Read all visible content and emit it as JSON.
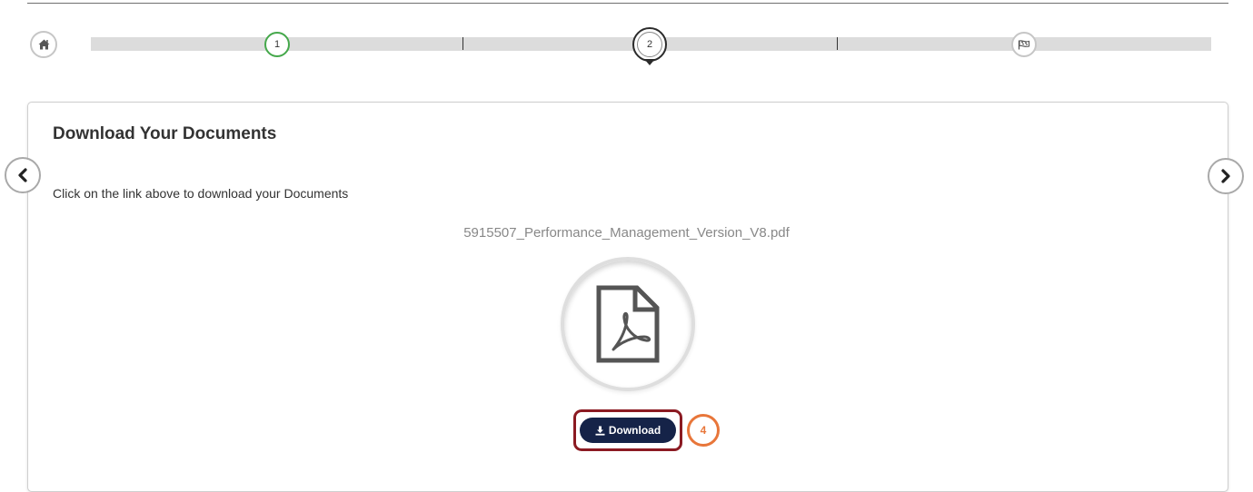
{
  "wizard": {
    "steps": [
      {
        "label": "",
        "icon": "home-icon",
        "state": "complete"
      },
      {
        "label": "1",
        "state": "complete",
        "color": "#45a84b"
      },
      {
        "label": "2",
        "state": "current"
      },
      {
        "label": "",
        "icon": "finish-flag-icon",
        "state": "upcoming"
      }
    ]
  },
  "panel": {
    "title": "Download Your Documents",
    "instruction": "Click on the link above to download your Documents",
    "file_name": "5915507_Performance_Management_Version_V8.pdf",
    "file_icon": "pdf-file-icon",
    "download_label": "Download",
    "download_icon": "download-icon"
  },
  "nav": {
    "prev_icon": "chevron-left-icon",
    "next_icon": "chevron-right-icon"
  },
  "annotation": {
    "callout_number": "4",
    "highlight_color": "#8b1a22",
    "callout_color": "#e8763a"
  },
  "colors": {
    "button_bg": "#152348",
    "step_complete": "#45a84b"
  }
}
